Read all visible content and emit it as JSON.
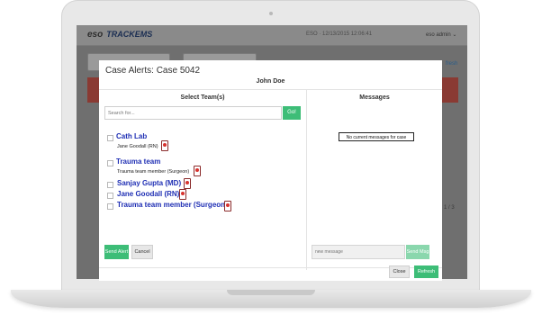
{
  "app": {
    "logo_brand": "eso",
    "logo_product": "TRACKEMS",
    "info": "ESO · 12/13/2015 12:06:41",
    "user": "eso admin ⌄",
    "bg_link": "fresh",
    "bg_pagination": "1 / 3"
  },
  "modal": {
    "title": "Case Alerts: Case 5042",
    "patient": "John Doe",
    "left_heading": "Select Team(s)",
    "right_heading": "Messages",
    "search_placeholder": "Search for...",
    "go_label": "Go!",
    "teams": [
      {
        "name": "Cath Lab",
        "members": [
          "Jane Goodall (RN)"
        ]
      },
      {
        "name": "Trauma team",
        "members": [
          "Trauma team member (Surgeon)"
        ]
      }
    ],
    "individuals": [
      {
        "name": "Sanjay Gupta (MD)"
      },
      {
        "name": "Jane Goodall (RN)"
      },
      {
        "name": "Trauma team member (Surgeon)"
      }
    ],
    "send_alert_label": "Send Alert",
    "cancel_label": "Cancel",
    "no_messages": "No current messages for case",
    "message_placeholder": "new message",
    "send_msg_label": "Send Msg",
    "close_label": "Close",
    "refresh_label": "Refresh"
  },
  "colors": {
    "accent_green": "#3dbd77",
    "team_link_blue": "#1f2fb4",
    "phone_red": "#d8332f"
  }
}
